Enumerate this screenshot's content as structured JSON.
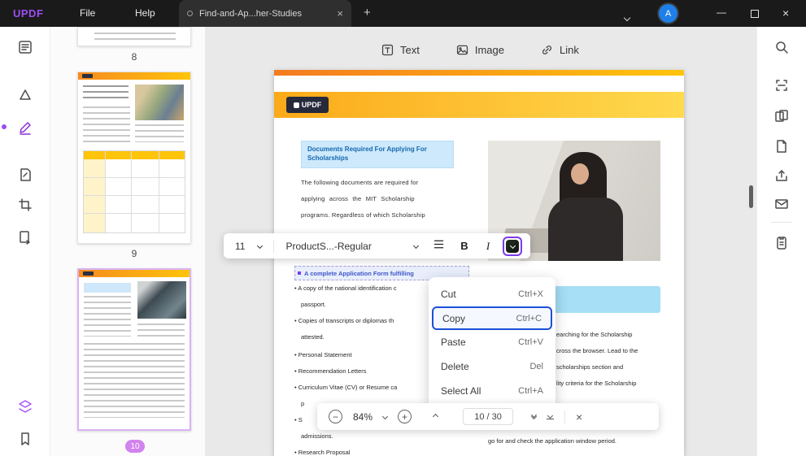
{
  "titlebar": {
    "logo": "UPDF",
    "menu_file": "File",
    "menu_help": "Help",
    "tab_title": "Find-and-Ap...her-Studies",
    "avatar_letter": "A"
  },
  "icons": {
    "plus": "+",
    "close": "×",
    "minus": "−",
    "minimize": "—"
  },
  "canvas_toolbar": {
    "text_label": "Text",
    "image_label": "Image",
    "link_label": "Link"
  },
  "thumbnails": {
    "page8": "8",
    "page9": "9",
    "page10": "10"
  },
  "format_toolbar": {
    "font_size": "11",
    "font_name": "ProductS...-Regular",
    "bold": "B",
    "italic": "I"
  },
  "context_menu": {
    "items": [
      {
        "label": "Cut",
        "shortcut": "Ctrl+X"
      },
      {
        "label": "Copy",
        "shortcut": "Ctrl+C"
      },
      {
        "label": "Paste",
        "shortcut": "Ctrl+V"
      },
      {
        "label": "Delete",
        "shortcut": "Del"
      },
      {
        "label": "Select All",
        "shortcut": "Ctrl+A"
      }
    ]
  },
  "bottom_toolbar": {
    "zoom": "84%",
    "page_indicator": "10 / 30"
  },
  "document": {
    "page_logo": "UPDF",
    "heading": "Documents Required For Applying For Scholarships",
    "intro_line1": "The following documents are required for",
    "intro_line2": "applying across the MIT Scholarship",
    "intro_line3": "programs. Regardless of which Scholarship",
    "selected_text": "A complete Application Form fulfilling",
    "left_lines": [
      "• A copy of the national identification c",
      "passport.",
      "• Copies of transcripts or diplomas th",
      "attested.",
      "• Personal Statement",
      "• Recommendation Letters",
      "• Curriculum Vitae (CV) or Resume ca",
      "p",
      "• S",
      "admissions.",
      "• Research Proposal"
    ],
    "right_lines": [
      "earching for the Scholarship",
      "cross the browser. Lead to the",
      "scholarships section and",
      "lity criteria for the Scholarship"
    ],
    "right_bottom_line": "go for and check the application window period."
  }
}
